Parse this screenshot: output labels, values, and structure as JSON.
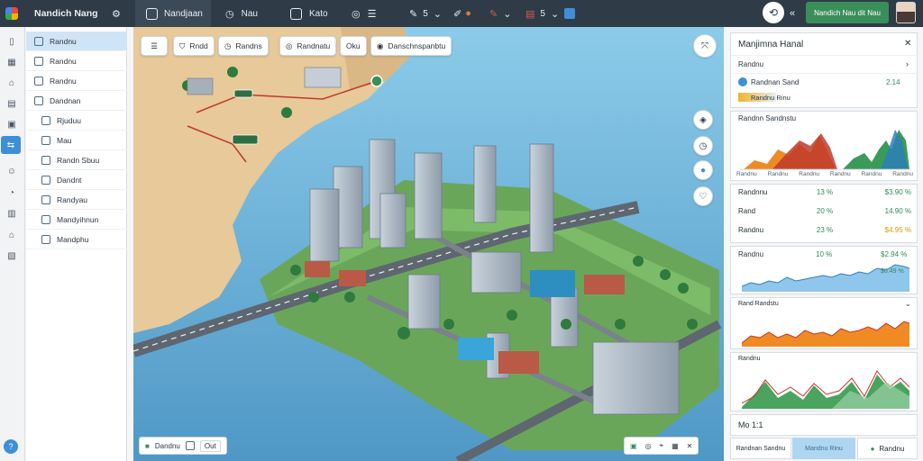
{
  "app": {
    "title": "Nandich Nang"
  },
  "topbar": {
    "tab1": "Nandjaan",
    "tab2": "Nau",
    "tab3": "Kato",
    "num1": "5",
    "num2": "5",
    "action_label": "Nandich Nau dit Nau"
  },
  "sidebar": {
    "items": [
      {
        "label": "Randnu"
      },
      {
        "label": "Randnu"
      },
      {
        "label": "Randnu"
      },
      {
        "label": "Dandnan"
      },
      {
        "label": "Rjuduu"
      },
      {
        "label": "Mau"
      },
      {
        "label": "Randn Sbuu"
      },
      {
        "label": "Dandnt"
      },
      {
        "label": "Randyau"
      },
      {
        "label": "Mandyihnun"
      },
      {
        "label": "Mandphu"
      }
    ]
  },
  "map_toolbar": {
    "chips": [
      "",
      "Rndd",
      "Randns",
      "Randnatu",
      "Oku",
      "Danschnspanbtu"
    ]
  },
  "map_footer": {
    "left_label": "Dandnu",
    "left_btn": "Out"
  },
  "panel": {
    "title": "Manjimna Hanal",
    "subtitle": "Randnu",
    "stat_label": "Randnan Sand",
    "stat_value": "2.14",
    "stat_sub": "Randnu Rinu",
    "chart1_title": "Randnn Sandnstu",
    "chart1_labels": [
      "Randnu",
      "Randnu",
      "Randnu",
      "Randnu",
      "Randnu",
      "Randnu"
    ],
    "rows": [
      {
        "label": "Randnnu",
        "pct": "13 %",
        "value": "$3.90 %",
        "color": "#2e8b57"
      },
      {
        "label": "Rand",
        "pct": "20 %",
        "value": "14.90 %",
        "color": "#2e8b57"
      },
      {
        "label": "Randnu",
        "pct": "23 %",
        "value": "$4.95 %",
        "color": "#d89b00"
      }
    ],
    "chart2_title": "Randnu",
    "chart2_pct": "10 %",
    "chart2_value": "$2.94 %",
    "chart2_value2": "$0.49 %",
    "chart3_title": "Rand Randstu",
    "chart4_title": "Randnu",
    "footer_label": "Mo 1:1",
    "footer_tab1": "Randnan Sandnu",
    "footer_tab2": "Mandnu Rinu",
    "footer_btn": "Randnu"
  },
  "colors": {
    "accent": "#3d8fd8",
    "topbar": "#2f3b47",
    "green_btn": "#3a8e5a",
    "water": "#6ab0d8"
  }
}
